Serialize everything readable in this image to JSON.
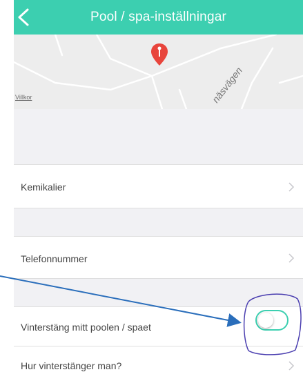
{
  "header": {
    "title": "Pool / spa-inställningar"
  },
  "map": {
    "road_label": "näsvägen",
    "terms_link": "Villkor"
  },
  "settings": {
    "chemicals_label": "Kemikalier",
    "phone_label": "Telefonnummer",
    "winterize_label": "Vinterstäng mitt poolen / spaet",
    "winterize_enabled": false,
    "how_to_winterize_label": "Hur vinterstänger man?"
  },
  "colors": {
    "header": "#3ccfb0",
    "toggle_border": "#3ccfb0",
    "map_pin": "#e8453c",
    "annotation_arrow": "#2a6ebb",
    "annotation_circle": "#4b3fb0",
    "section_gap": "#f1f1f4"
  },
  "icons": [
    "chevron-left-icon",
    "map-pin-icon",
    "chevron-right-icon"
  ]
}
